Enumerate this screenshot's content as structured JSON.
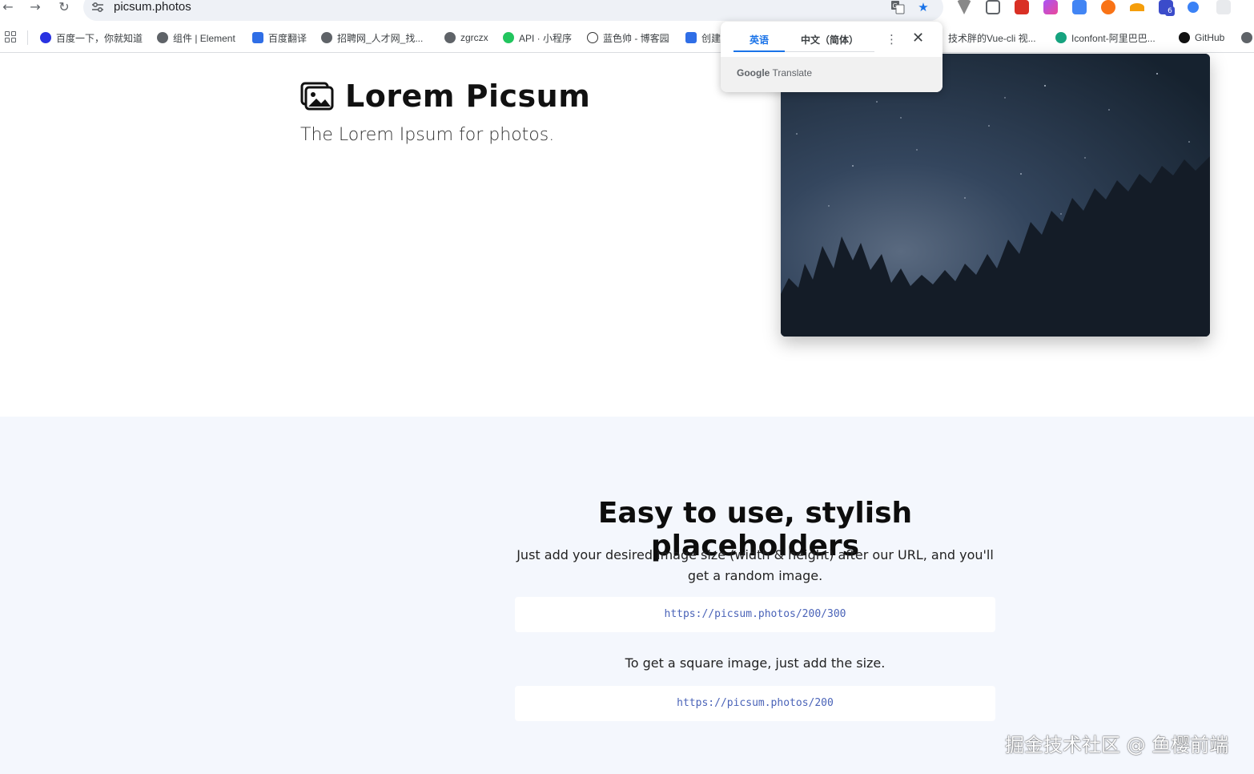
{
  "browser": {
    "url": "picsum.photos",
    "back_icon": "back-arrow-icon",
    "forward_icon": "forward-arrow-icon",
    "reload_icon": "reload-icon",
    "extensions_badge": "6"
  },
  "bookmarks": [
    {
      "label": "百度一下，你就知道",
      "color": "#2932e1"
    },
    {
      "label": "组件 | Element",
      "color": "#5f6368"
    },
    {
      "label": "百度翻译",
      "color": "#2f6ee6"
    },
    {
      "label": "招聘网_人才网_找...",
      "color": "#5f6368"
    },
    {
      "label": "zgrczx",
      "color": "#5f6368"
    },
    {
      "label": "API · 小程序",
      "color": "#22c55e"
    },
    {
      "label": "蓝色帅 - 博客园",
      "color": "#333333"
    },
    {
      "label": "创建",
      "color": "#2f6ee6"
    },
    {
      "label": "技术胖的Vue-cli 视...",
      "color": "#5f6368"
    },
    {
      "label": "Iconfont-阿里巴巴...",
      "color": "#16a37f"
    },
    {
      "label": "GitHub",
      "color": "#111111"
    }
  ],
  "translate_popup": {
    "tab_source": "英语",
    "tab_target": "中文（简体）",
    "brand_google": "Google",
    "brand_translate": "Translate"
  },
  "hero": {
    "title": "Lorem Picsum",
    "tagline": "The Lorem Ipsum for photos."
  },
  "section2": {
    "title": "Easy to use, stylish placeholders",
    "description": "Just add your desired image size (width & height) after our URL, and you'll get a random image.",
    "example_url_1": "https://picsum.photos/200/300",
    "square_note": "To get a square image, just add the size.",
    "example_url_2": "https://picsum.photos/200"
  },
  "watermark": "掘金技术社区 @ 鱼樱前端"
}
